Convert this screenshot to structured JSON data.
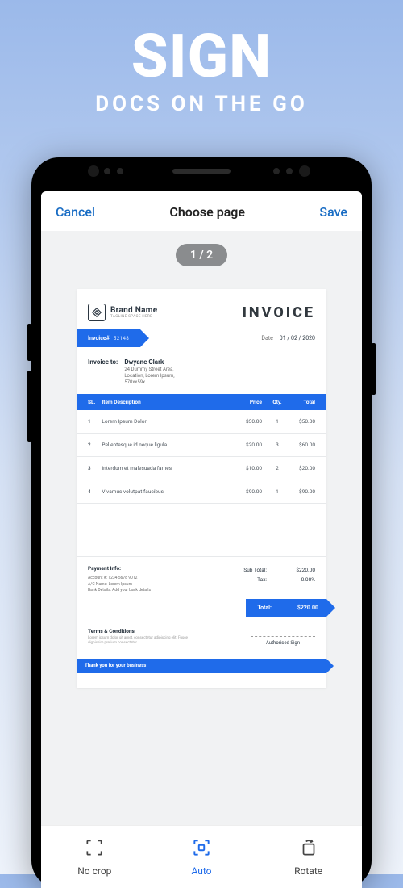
{
  "hero": {
    "title": "SIGN",
    "subtitle": "DOCS ON THE GO"
  },
  "header": {
    "cancel": "Cancel",
    "title": "Choose page",
    "save": "Save"
  },
  "page_badge": "1 / 2",
  "tabs": {
    "nocrop": "No crop",
    "auto": "Auto",
    "rotate": "Rotate"
  },
  "invoice": {
    "brand_name": "Brand Name",
    "brand_tag": "TAGLINE SPACE HERE",
    "title": "INVOICE",
    "invoice_label": "Invoice#",
    "invoice_num": "52148",
    "date_label": "Date",
    "date_value": "01 / 02 / 2020",
    "to_label": "Invoice to:",
    "to_name": "Dwyane Clark",
    "to_addr_1": "24 Dummy Street Area,",
    "to_addr_2": "Location, Lorem Ipsum,",
    "to_addr_3": "570xx59x",
    "columns": {
      "sl": "SL.",
      "desc": "Item Description",
      "price": "Price",
      "qty": "Qty.",
      "total": "Total"
    },
    "rows": [
      {
        "sl": "1",
        "desc": "Lorem Ipsum Dolor",
        "price": "$50.00",
        "qty": "1",
        "total": "$50.00"
      },
      {
        "sl": "2",
        "desc": "Pellentesque id neque ligula",
        "price": "$20.00",
        "qty": "3",
        "total": "$60.00"
      },
      {
        "sl": "3",
        "desc": "Interdum et malesuada fames",
        "price": "$10.00",
        "qty": "2",
        "total": "$20.00"
      },
      {
        "sl": "4",
        "desc": "Vivamus volutpat faucibus",
        "price": "$90.00",
        "qty": "1",
        "total": "$90.00"
      }
    ],
    "pay_header": "Payment Info:",
    "pay_l1": "Account #:   1234 5678 9012",
    "pay_l2": "A/C Name:   Lorem Ipsum",
    "pay_l3": "Bank Details:   Add your bank details",
    "subtotal_label": "Sub Total:",
    "subtotal_value": "$220.00",
    "tax_label": "Tax:",
    "tax_value": "0.00%",
    "total_label": "Total:",
    "total_value": "$220.00",
    "terms_header": "Terms & Conditions",
    "terms_text": "Lorem ipsum dolor sit amet, consectetur adipiscing elit. Fusce dignissim pretium consectetur.",
    "auth_sign": "Authorised Sign",
    "thanks": "Thank you for your business"
  }
}
